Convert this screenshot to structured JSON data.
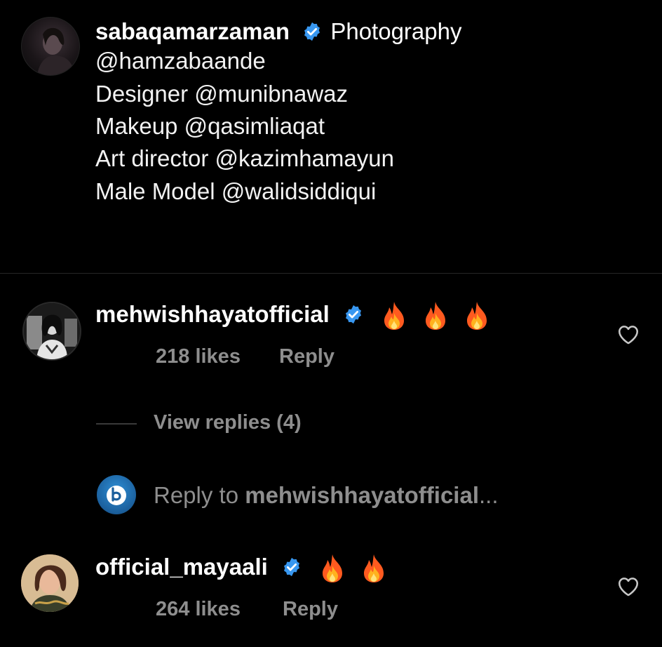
{
  "caption": {
    "username": "sabaqamarzaman",
    "first_line_text": "Photography",
    "lines": [
      "@hamzabaande",
      "Designer @munibnawaz",
      "Makeup @qasimliaqat",
      "Art director @kazimhamayun",
      "Male Model @walidsiddiqui"
    ]
  },
  "comments": [
    {
      "username": "mehwishhayatofficial",
      "verified": true,
      "emoji_count": 3,
      "likes": "218 likes",
      "reply_label": "Reply",
      "view_replies": "View replies (4)"
    },
    {
      "username": "official_mayaali",
      "verified": true,
      "emoji_count": 2,
      "likes": "264 likes",
      "reply_label": "Reply"
    }
  ],
  "reply_composer": {
    "prefix": "Reply to ",
    "target": "mehwishhayatofficial",
    "suffix": "..."
  },
  "colors": {
    "background": "#000000",
    "muted_text": "#8e8e8e",
    "verified_blue": "#3897f0",
    "divider": "#262626"
  },
  "icons": {
    "verified": "verified-badge-icon",
    "like": "heart-outline-icon",
    "emoji": "fire-emoji-icon"
  }
}
